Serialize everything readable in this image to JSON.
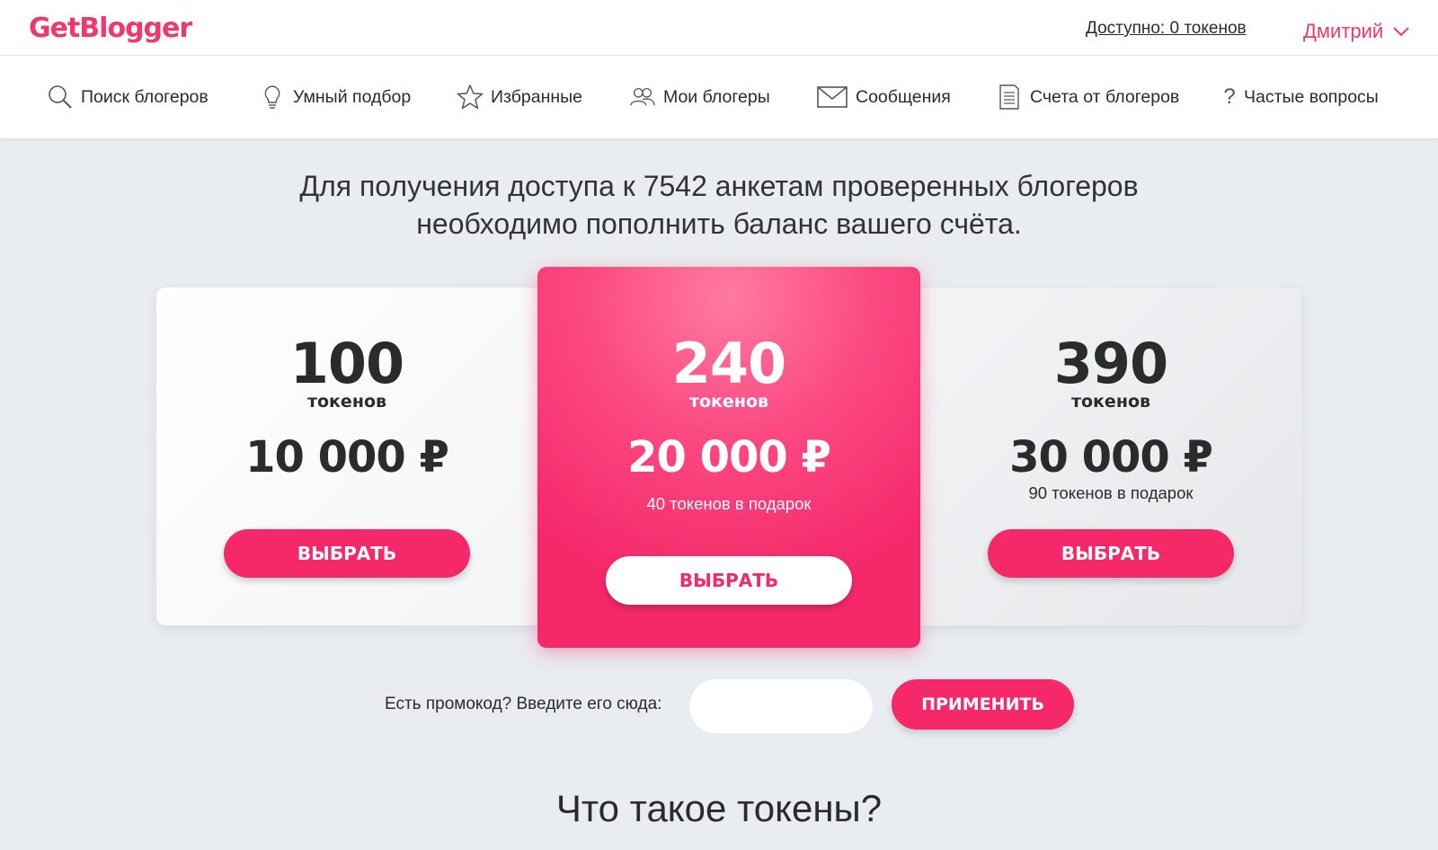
{
  "header": {
    "logo_text": "GetBlogger",
    "balance_link": "Доступно: 0 токенов",
    "user_name": "Дмитрий"
  },
  "nav": {
    "items": [
      {
        "label": "Поиск блогеров",
        "icon": "search-icon"
      },
      {
        "label": "Умный подбор",
        "icon": "lightbulb-icon"
      },
      {
        "label": "Избранные",
        "icon": "star-icon"
      },
      {
        "label": "Мои блогеры",
        "icon": "users-icon"
      },
      {
        "label": "Сообщения",
        "icon": "envelope-icon"
      },
      {
        "label": "Счета от блогеров",
        "icon": "document-icon"
      },
      {
        "label": "Частые вопросы",
        "icon": "question-icon"
      }
    ]
  },
  "headline": {
    "line1": "Для получения доступа к 7542 анкетам проверенных блогеров",
    "line2": "необходимо пополнить баланс вашего счёта."
  },
  "plans": [
    {
      "tokens": "100",
      "unit": "токенов",
      "price": "10 000 ₽",
      "bonus": "",
      "button": "ВЫБРАТЬ"
    },
    {
      "tokens": "240",
      "unit": "токенов",
      "price": "20 000 ₽",
      "bonus": "40 токенов в подарок",
      "button": "ВЫБРАТЬ"
    },
    {
      "tokens": "390",
      "unit": "токенов",
      "price": "30 000 ₽",
      "bonus": "90 токенов в подарок",
      "button": "ВЫБРАТЬ"
    }
  ],
  "promo": {
    "label": "Есть промокод? Введите его сюда:",
    "input_value": "",
    "button": "ПРИМЕНИТЬ"
  },
  "section_title": "Что такое токены?",
  "colors": {
    "accent": "#f5286a",
    "background": "#e9ecf0"
  }
}
